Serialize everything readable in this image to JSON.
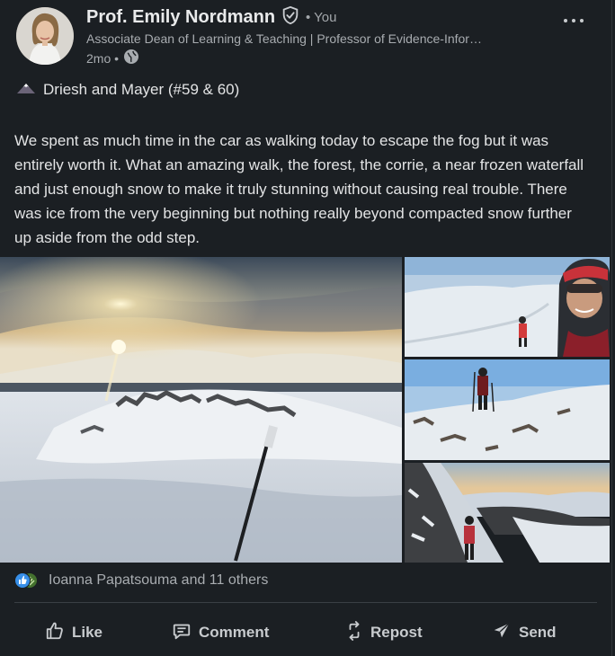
{
  "author": {
    "name": "Prof. Emily Nordmann",
    "connection": "• You",
    "headline": "Associate Dean of Learning & Teaching | Professor of Evidence-Infor…",
    "time": "2mo •"
  },
  "post": {
    "title": "Driesh and Mayer (#59 & 60)",
    "body": "We spent as much time in the car as walking today to escape the fog but it was entirely worth it. What an amazing walk, the forest, the corrie, a near frozen waterfall and just enough snow to make it truly stunning without causing real trouble. There was ice from the very beginning but nothing really beyond compacted snow further up aside from the odd step."
  },
  "reactions": {
    "text": "Ioanna Papatsouma and 11 others"
  },
  "actions": {
    "like": "Like",
    "comment": "Comment",
    "repost": "Repost",
    "send": "Send"
  },
  "colors": {
    "background": "#1b1f23",
    "text": "#e8e9ea",
    "muted": "#a8acb0",
    "like_blue": "#378fe9",
    "celebrate_green": "#44712e"
  },
  "icons": [
    "verified-icon",
    "globe-icon",
    "more-icon",
    "mountain-icon",
    "like-reaction-icon",
    "celebrate-reaction-icon",
    "like-icon",
    "comment-icon",
    "repost-icon",
    "send-icon"
  ]
}
